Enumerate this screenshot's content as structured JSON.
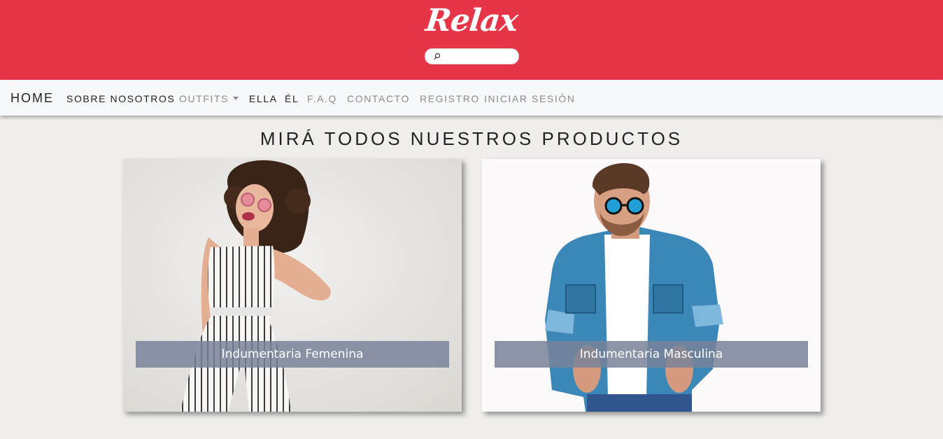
{
  "header": {
    "logo_text": "Relax",
    "search": {
      "placeholder": "",
      "value": "",
      "icon": "search-icon"
    },
    "background_color": "#e53547"
  },
  "navbar": {
    "brand": "HOME",
    "items": [
      {
        "label": "SOBRE NOSOTROS",
        "active": true
      },
      {
        "label": "OUTFITS",
        "active": false,
        "dropdown": true
      },
      {
        "label": "ELLA",
        "active": true
      },
      {
        "label": "ÉL",
        "active": true
      },
      {
        "label": "F.A.Q",
        "active": false
      },
      {
        "label": "CONTACTO",
        "active": false
      },
      {
        "label": "REGISTRO",
        "active": false
      },
      {
        "label": "INICIAR SESIÓN",
        "active": false
      }
    ]
  },
  "main": {
    "heading": "MIRÁ TODOS NUESTROS PRODUCTOS",
    "cards": [
      {
        "caption": "Indumentaria Femenina",
        "image": "woman-photo"
      },
      {
        "caption": "Indumentaria Masculina",
        "image": "man-photo"
      }
    ]
  }
}
